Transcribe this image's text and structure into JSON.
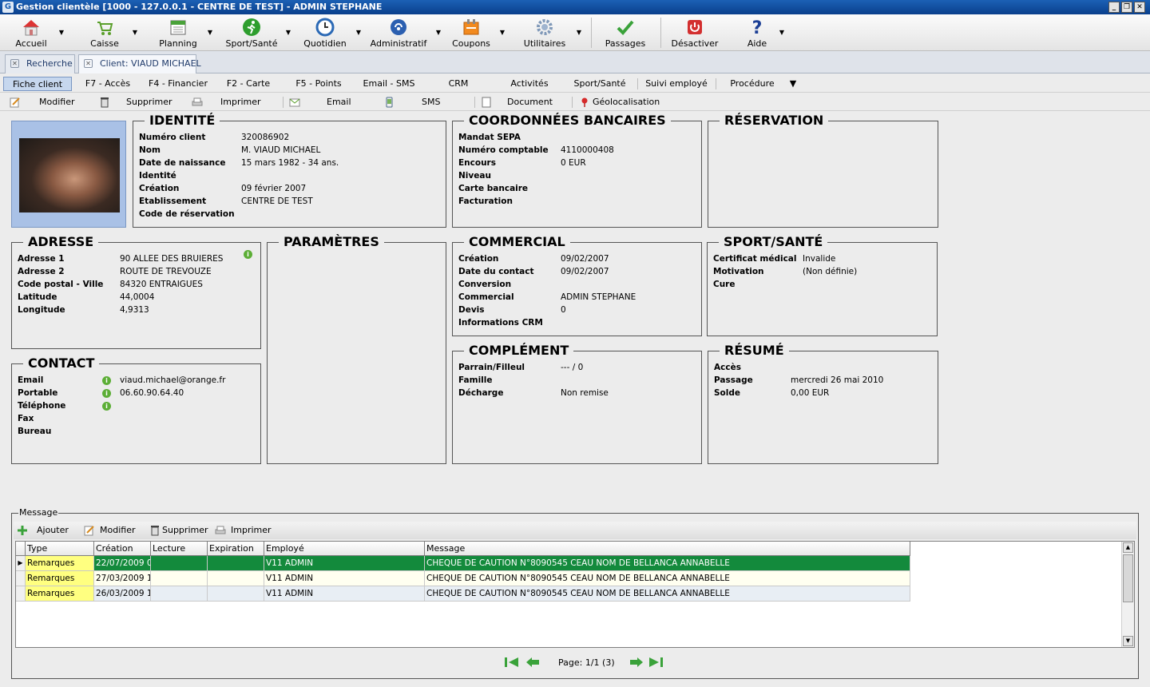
{
  "window": {
    "title": "Gestion clientèle [1000 - 127.0.0.1 - CENTRE DE TEST] - ADMIN STEPHANE"
  },
  "toolbar": [
    {
      "label": "Accueil",
      "icon": "home-icon"
    },
    {
      "label": "Caisse",
      "icon": "cart-icon"
    },
    {
      "label": "Planning",
      "icon": "calendar-icon"
    },
    {
      "label": "Sport/Santé",
      "icon": "runner-icon"
    },
    {
      "label": "Quotidien",
      "icon": "clock-icon"
    },
    {
      "label": "Administratif",
      "icon": "admin-icon"
    },
    {
      "label": "Coupons",
      "icon": "coupon-icon"
    },
    {
      "label": "Utilitaires",
      "icon": "gear-icon"
    },
    {
      "label": "Passages",
      "icon": "checkmark-icon"
    },
    {
      "label": "Désactiver",
      "icon": "power-icon"
    },
    {
      "label": "Aide",
      "icon": "question-icon"
    }
  ],
  "tabs": [
    {
      "label": "Recherche"
    },
    {
      "label": "Client: VIAUD MICHAEL"
    }
  ],
  "menu": [
    "Fiche client",
    "F7 - Accès",
    "F4 - Financier",
    "F2 - Carte",
    "F5 - Points",
    "Email - SMS",
    "CRM",
    "Activités",
    "Sport/Santé",
    "Suivi employé",
    "Procédure"
  ],
  "actions": [
    "Modifier",
    "Supprimer",
    "Imprimer",
    "Email",
    "SMS",
    "Document",
    "Géolocalisation"
  ],
  "identite": {
    "title": "IDENTITÉ",
    "rows": [
      {
        "k": "Numéro client",
        "v": "320086902"
      },
      {
        "k": "Nom",
        "v": "M. VIAUD MICHAEL"
      },
      {
        "k": "Date de naissance",
        "v": "15 mars 1982 - 34 ans."
      },
      {
        "k": "Identité",
        "v": ""
      },
      {
        "k": "Création",
        "v": "09 février 2007"
      },
      {
        "k": "Etablissement",
        "v": "CENTRE DE TEST"
      },
      {
        "k": "Code de réservation",
        "v": ""
      }
    ]
  },
  "bancaire": {
    "title": "COORDONNÉES BANCAIRES",
    "rows": [
      {
        "k": "Mandat SEPA",
        "v": ""
      },
      {
        "k": "Numéro comptable",
        "v": "4110000408"
      },
      {
        "k": "Encours",
        "v": "0 EUR"
      },
      {
        "k": "Niveau",
        "v": ""
      },
      {
        "k": "Carte bancaire",
        "v": ""
      },
      {
        "k": "Facturation",
        "v": ""
      }
    ]
  },
  "reservation": {
    "title": "RÉSERVATION"
  },
  "adresse": {
    "title": "ADRESSE",
    "rows": [
      {
        "k": "Adresse 1",
        "v": "90 ALLEE DES BRUIERES"
      },
      {
        "k": "Adresse 2",
        "v": "ROUTE DE TREVOUZE"
      },
      {
        "k": "Code postal - Ville",
        "v": "84320 ENTRAIGUES"
      },
      {
        "k": "Latitude",
        "v": "44,0004"
      },
      {
        "k": "Longitude",
        "v": "4,9313"
      }
    ]
  },
  "parametres": {
    "title": "PARAMÈTRES"
  },
  "commercial": {
    "title": "COMMERCIAL",
    "rows": [
      {
        "k": "Création",
        "v": "09/02/2007"
      },
      {
        "k": "Date du contact",
        "v": "09/02/2007"
      },
      {
        "k": "Conversion",
        "v": ""
      },
      {
        "k": "Commercial",
        "v": "ADMIN STEPHANE"
      },
      {
        "k": "Devis",
        "v": "0"
      },
      {
        "k": "Informations CRM",
        "v": ""
      }
    ]
  },
  "sport": {
    "title": "SPORT/SANTÉ",
    "rows": [
      {
        "k": "Certificat médical",
        "v": "Invalide"
      },
      {
        "k": "Motivation",
        "v": "(Non définie)"
      },
      {
        "k": "Cure",
        "v": ""
      }
    ]
  },
  "contact": {
    "title": "CONTACT",
    "rows": [
      {
        "k": "Email",
        "v": "viaud.michael@orange.fr"
      },
      {
        "k": "Portable",
        "v": "06.60.90.64.40"
      },
      {
        "k": "Téléphone",
        "v": ""
      },
      {
        "k": "Fax",
        "v": ""
      },
      {
        "k": "Bureau",
        "v": ""
      }
    ]
  },
  "complement": {
    "title": "COMPLÉMENT",
    "rows": [
      {
        "k": "Parrain/Filleul",
        "v": "--- / 0"
      },
      {
        "k": "Famille",
        "v": ""
      },
      {
        "k": "Décharge",
        "v": "Non remise"
      }
    ]
  },
  "resume": {
    "title": "RÉSUMÉ",
    "rows": [
      {
        "k": "Accès",
        "v": ""
      },
      {
        "k": "Passage",
        "v": "mercredi 26 mai 2010"
      },
      {
        "k": "Solde",
        "v": "0,00 EUR"
      }
    ]
  },
  "message": {
    "legend": "Message",
    "actions": [
      "Ajouter",
      "Modifier",
      "Supprimer",
      "Imprimer"
    ],
    "columns": [
      "Type",
      "Création",
      "Lecture",
      "Expiration",
      "Employé",
      "Message"
    ],
    "rows": [
      [
        "Remarques",
        "22/07/2009 0",
        "",
        "",
        "V11 ADMIN",
        "CHEQUE DE CAUTION N°8090545 CEAU NOM DE BELLANCA ANNABELLE"
      ],
      [
        "Remarques",
        "27/03/2009 1",
        "",
        "",
        "V11 ADMIN",
        "CHEQUE DE CAUTION N°8090545 CEAU NOM DE BELLANCA ANNABELLE"
      ],
      [
        "Remarques",
        "26/03/2009 1",
        "",
        "",
        "V11 ADMIN",
        "CHEQUE DE CAUTION N°8090545 CEAU NOM DE BELLANCA ANNABELLE"
      ]
    ],
    "page": "Page: 1/1 (3)"
  },
  "colors": {
    "accent": "#1c61b5",
    "selected_row": "#138a3c",
    "type_cell": "#ffff80",
    "info": "#5cae36"
  }
}
